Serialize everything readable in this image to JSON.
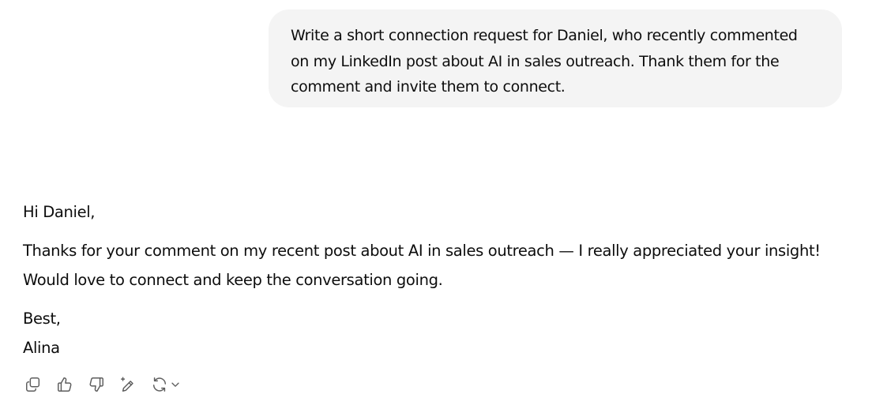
{
  "user_message": {
    "text": "Write a short connection request for Daniel, who recently commented\non my LinkedIn post about AI in sales outreach. Thank them for the\ncomment and invite them to connect."
  },
  "assistant_message": {
    "greeting": "Hi Daniel,",
    "body_line1": "Thanks for your comment on my recent post about AI in sales outreach — I really appreciated your insight!",
    "body_line2": "Would love to connect and keep the conversation going.",
    "signoff": "Best,",
    "signature": "Alina"
  },
  "actions": {
    "icons": [
      "copy-icon",
      "thumbs-up-icon",
      "thumbs-down-icon",
      "edit-sparkle-icon",
      "regenerate-icon",
      "chevron-down-icon"
    ]
  }
}
